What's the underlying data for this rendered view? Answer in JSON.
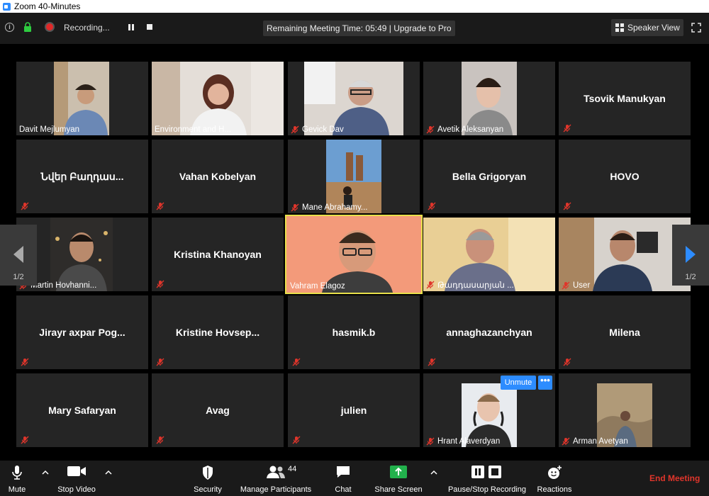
{
  "window": {
    "title": "Zoom 40-Minutes"
  },
  "status": {
    "recording_text": "Recording...",
    "remaining_text": "Remaining Meeting Time: 05:49 | Upgrade to Pro",
    "view_label": "Speaker View"
  },
  "pager": {
    "left": "1/2",
    "right": "1/2"
  },
  "tiles": [
    {
      "name": "Davit Mejlumyan"
    },
    {
      "name": "Environment and H..."
    },
    {
      "name": "Gevick Dav"
    },
    {
      "name": "Avetik Aleksanyan"
    },
    {
      "name": "Tsovik Manukyan"
    },
    {
      "name": "Նվեր Բաղդաս..."
    },
    {
      "name": "Vahan Kobelyan"
    },
    {
      "name": "Mane Abrahamy..."
    },
    {
      "name": "Bella Grigoryan"
    },
    {
      "name": "HOVO"
    },
    {
      "name": "Martin Hovhanni..."
    },
    {
      "name": "Kristina Khanoyan"
    },
    {
      "name": "Vahram Elagoz"
    },
    {
      "name": "Թադդասարյան ..."
    },
    {
      "name": "User"
    },
    {
      "name": "Jirayr axpar Pog..."
    },
    {
      "name": "Kristine Hovsep..."
    },
    {
      "name": "hasmik.b"
    },
    {
      "name": "annaghazanchyan"
    },
    {
      "name": "Milena"
    },
    {
      "name": "Mary Safaryan"
    },
    {
      "name": "Avag"
    },
    {
      "name": "julien"
    },
    {
      "name": "Hrant Alaverdyan"
    },
    {
      "name": "Arman Avetyan"
    }
  ],
  "overlay": {
    "unmute": "Unmute",
    "more": "•••"
  },
  "toolbar": {
    "mute": "Mute",
    "stop_video": "Stop Video",
    "security": "Security",
    "participants": "Manage Participants",
    "participants_count": "44",
    "chat": "Chat",
    "share": "Share Screen",
    "recording": "Pause/Stop Recording",
    "reactions": "Reactions",
    "end": "End Meeting"
  },
  "colors": {
    "accent": "#2d8cff",
    "end": "#e0352b",
    "share": "#22b14c",
    "active_border": "#e8e04a",
    "mute_red": "#e0352b"
  }
}
